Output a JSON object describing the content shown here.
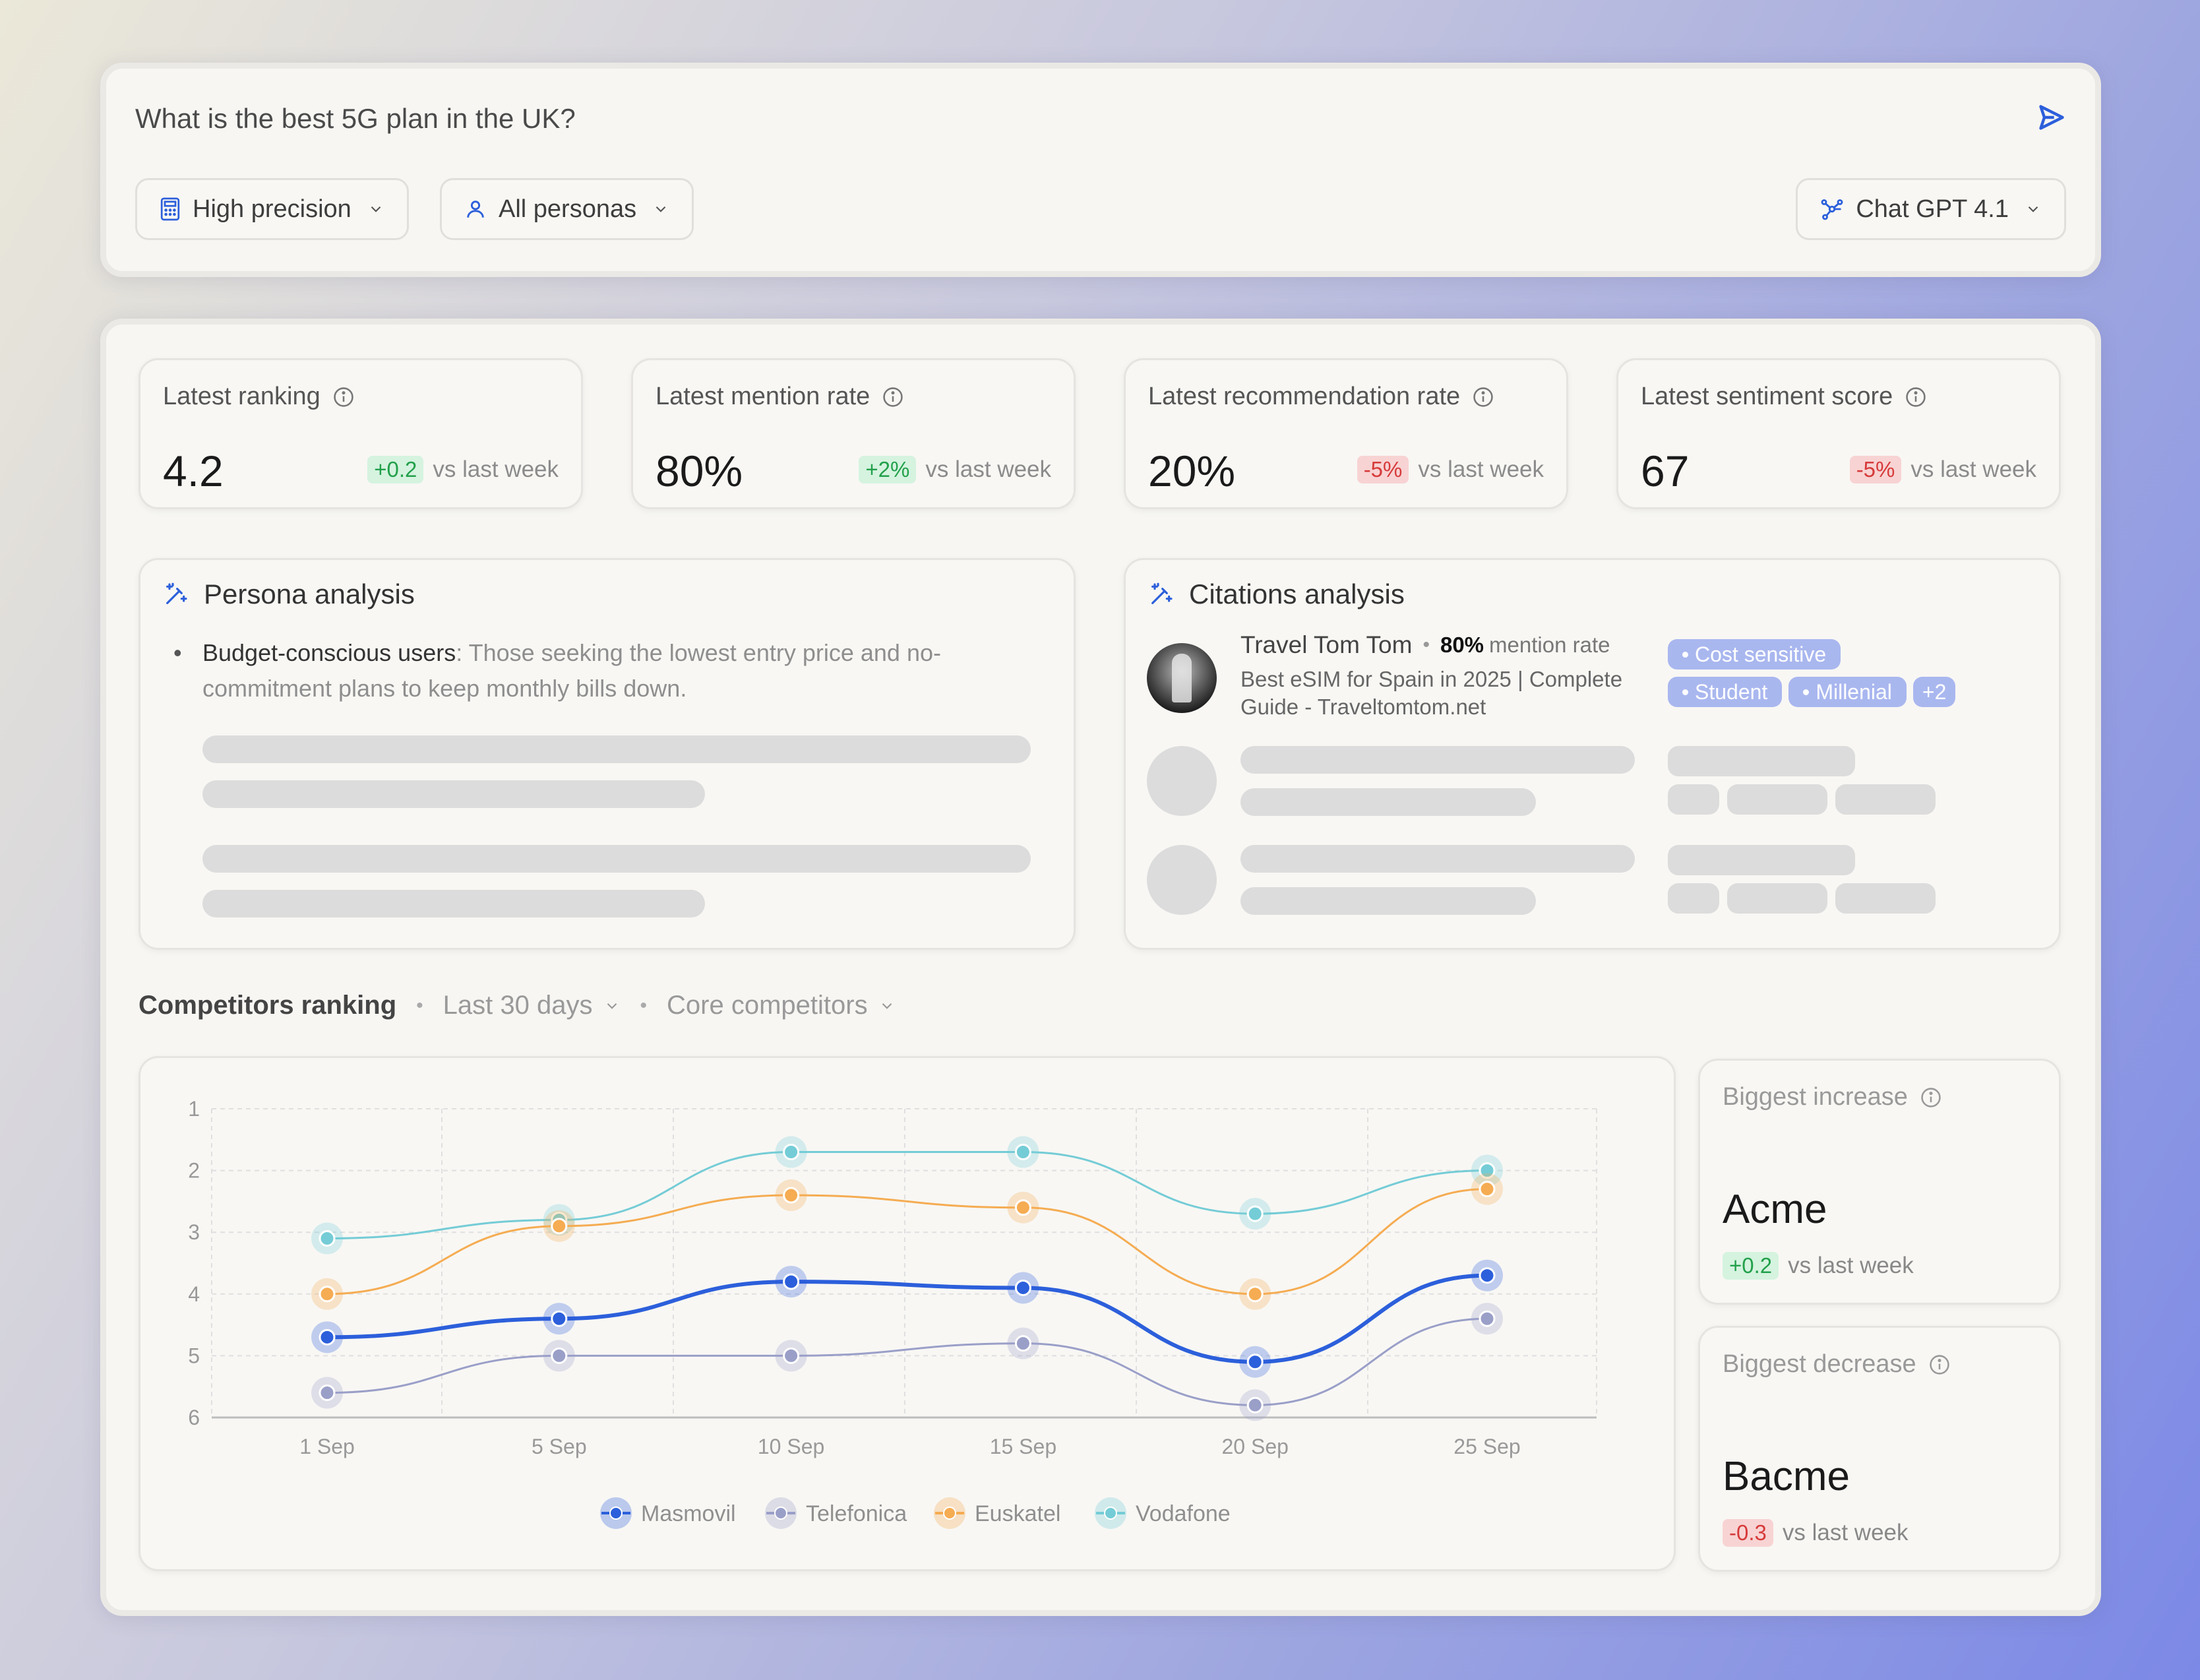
{
  "query": {
    "text": "What is the best 5G plan in the UK?",
    "precision_label": "High precision",
    "persona_label": "All personas",
    "model_label": "Chat GPT 4.1"
  },
  "metrics": [
    {
      "label": "Latest ranking",
      "value": "4.2",
      "delta": "+0.2",
      "delta_dir": "up",
      "suffix": "vs last week"
    },
    {
      "label": "Latest mention rate",
      "value": "80%",
      "delta": "+2%",
      "delta_dir": "up",
      "suffix": "vs last week"
    },
    {
      "label": "Latest recommendation rate",
      "value": "20%",
      "delta": "-5%",
      "delta_dir": "down",
      "suffix": "vs last week"
    },
    {
      "label": "Latest sentiment score",
      "value": "67",
      "delta": "-5%",
      "delta_dir": "down",
      "suffix": "vs last week"
    }
  ],
  "persona": {
    "title": "Persona analysis",
    "bullet_bold": "Budget-conscious users",
    "bullet_text": ": Those seeking the lowest entry price and no-commitment plans to keep monthly bills down."
  },
  "citations": {
    "title": "Citations analysis",
    "source_name": "Travel Tom Tom",
    "mention_value": "80%",
    "mention_suffix": "mention rate",
    "article": "Best eSIM for Spain in 2025 | Complete Guide - Traveltomtom.net",
    "tags": [
      "Cost sensitive",
      "Student",
      "Millenial"
    ],
    "more_tag": "+2"
  },
  "competitors": {
    "title": "Competitors ranking",
    "range_label": "Last 30 days",
    "group_label": "Core competitors"
  },
  "highlights": {
    "increase": {
      "label": "Biggest increase",
      "name": "Acme",
      "delta": "+0.2",
      "suffix": "vs last week"
    },
    "decrease": {
      "label": "Biggest decrease",
      "name": "Bacme",
      "delta": "-0.3",
      "suffix": "vs last week"
    }
  },
  "colors": {
    "accent": "#2c5fdb",
    "masmovil": "#2c5fdb",
    "telefonica": "#9a9fc8",
    "euskatel": "#f5ac52",
    "vodafone": "#74ccd6"
  },
  "chart_data": {
    "type": "line",
    "x": [
      "1 Sep",
      "5 Sep",
      "10 Sep",
      "15 Sep",
      "20 Sep",
      "25 Sep"
    ],
    "yticks": [
      "1",
      "2",
      "3",
      "4",
      "5",
      "6"
    ],
    "ylim": [
      1,
      6
    ],
    "y_inverted": true,
    "grid": true,
    "legend_position": "bottom",
    "series": [
      {
        "name": "Masmovil",
        "values": [
          4.7,
          4.4,
          3.8,
          3.9,
          5.1,
          3.7
        ]
      },
      {
        "name": "Telefonica",
        "values": [
          5.6,
          5.0,
          5.0,
          4.8,
          5.8,
          4.4
        ]
      },
      {
        "name": "Euskatel",
        "values": [
          4.0,
          2.9,
          2.4,
          2.6,
          4.0,
          2.3
        ]
      },
      {
        "name": "Vodafone",
        "values": [
          3.1,
          2.8,
          1.7,
          1.7,
          2.7,
          2.0
        ]
      }
    ]
  }
}
